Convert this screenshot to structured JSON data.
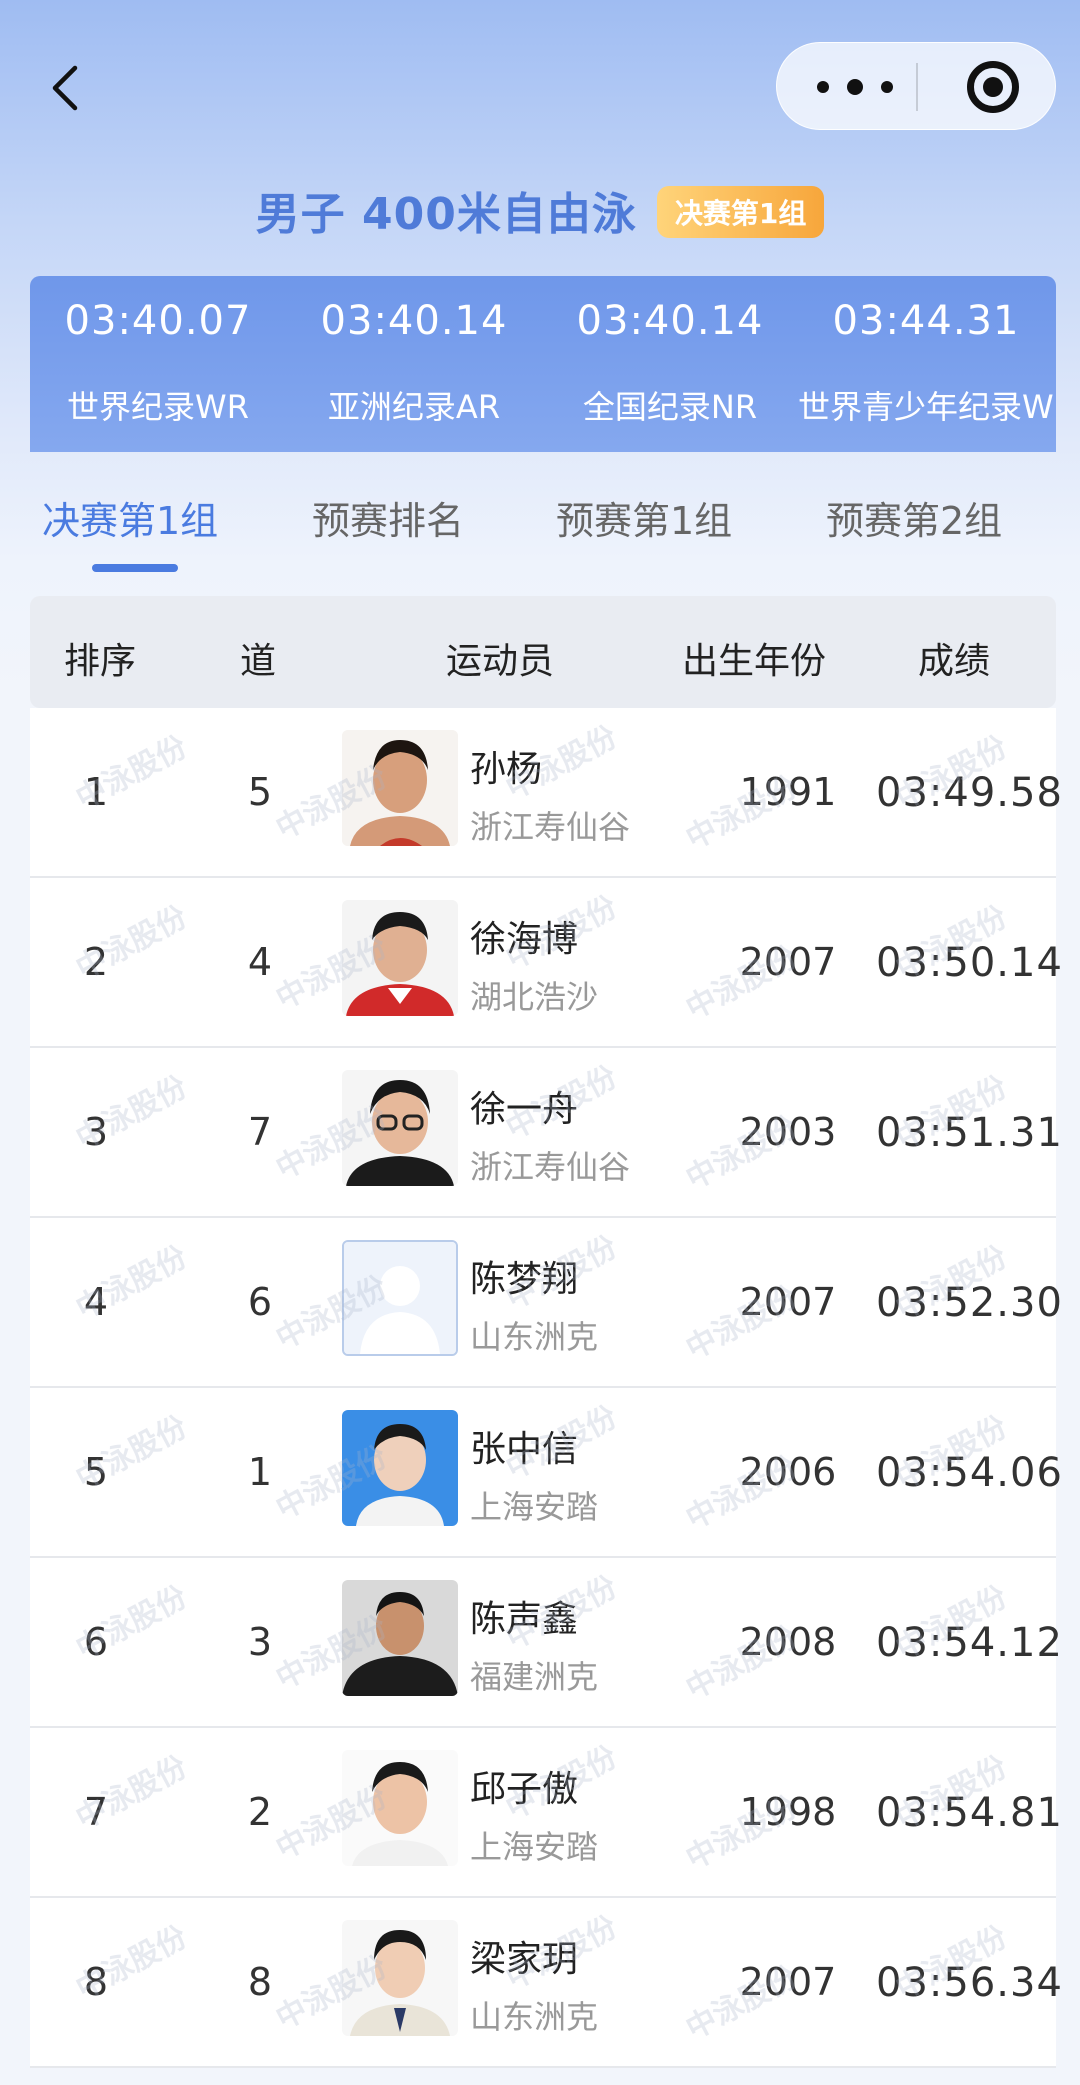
{
  "title": "男子 400米自由泳",
  "badge": "决赛第1组",
  "records": [
    {
      "time": "03:40.07",
      "label": "世界纪录WR"
    },
    {
      "time": "03:40.14",
      "label": "亚洲纪录AR"
    },
    {
      "time": "03:40.14",
      "label": "全国纪录NR"
    },
    {
      "time": "03:44.31",
      "label": "世界青少年纪录W"
    }
  ],
  "tabs": [
    "决赛第1组",
    "预赛排名",
    "预赛第1组",
    "预赛第2组"
  ],
  "active_tab": 0,
  "headers": {
    "rank": "排序",
    "lane": "道",
    "athlete": "运动员",
    "birth_year": "出生年份",
    "result": "成绩"
  },
  "rows": [
    {
      "rank": "1",
      "lane": "5",
      "name": "孙杨",
      "team": "浙江寿仙谷",
      "year": "1991",
      "result": "03:49.58"
    },
    {
      "rank": "2",
      "lane": "4",
      "name": "徐海博",
      "team": "湖北浩沙",
      "year": "2007",
      "result": "03:50.14"
    },
    {
      "rank": "3",
      "lane": "7",
      "name": "徐一舟",
      "team": "浙江寿仙谷",
      "year": "2003",
      "result": "03:51.31"
    },
    {
      "rank": "4",
      "lane": "6",
      "name": "陈梦翔",
      "team": "山东洲克",
      "year": "2007",
      "result": "03:52.30"
    },
    {
      "rank": "5",
      "lane": "1",
      "name": "张中信",
      "team": "上海安踏",
      "year": "2006",
      "result": "03:54.06"
    },
    {
      "rank": "6",
      "lane": "3",
      "name": "陈声鑫",
      "team": "福建洲克",
      "year": "2008",
      "result": "03:54.12"
    },
    {
      "rank": "7",
      "lane": "2",
      "name": "邱子傲",
      "team": "上海安踏",
      "year": "1998",
      "result": "03:54.81"
    },
    {
      "rank": "8",
      "lane": "8",
      "name": "梁家玥",
      "team": "山东洲克",
      "year": "2007",
      "result": "03:56.34"
    }
  ],
  "watermark": "中泳股份",
  "colors": {
    "accent": "#4a7be0",
    "title": "#4f7bd8",
    "badge": "#f7a63b",
    "records_bg": "#6f97ea"
  }
}
